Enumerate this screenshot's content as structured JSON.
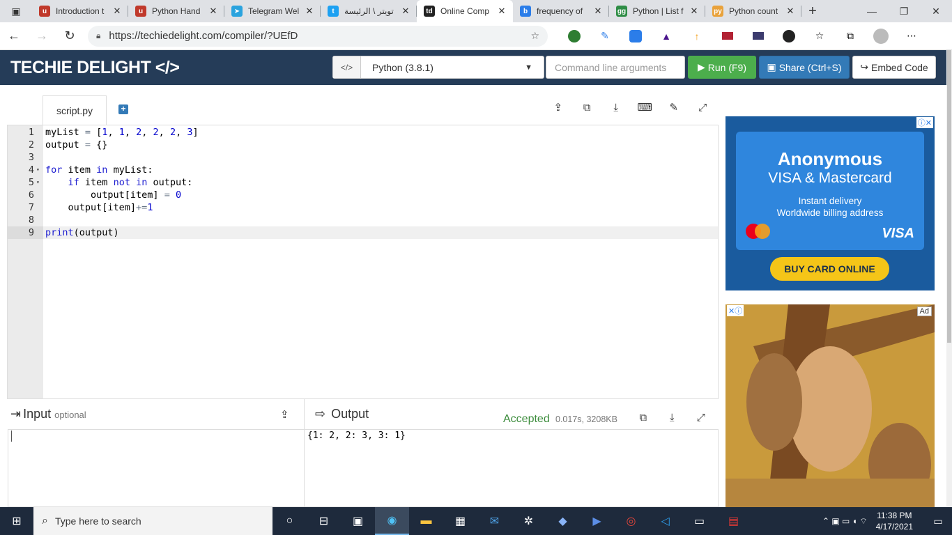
{
  "browser": {
    "tabs": [
      {
        "title": "Introduction t",
        "favicon": "u",
        "color": "#c0392b"
      },
      {
        "title": "Python Hand",
        "favicon": "u",
        "color": "#c0392b"
      },
      {
        "title": "Telegram Wel",
        "favicon": "➤",
        "color": "#2aa3de"
      },
      {
        "title": "تويتر \\ الرئيسة",
        "favicon": "t",
        "color": "#1da1f2"
      },
      {
        "title": "Online Comp",
        "favicon": "td",
        "color": "#222"
      },
      {
        "title": "frequency of",
        "favicon": "b",
        "color": "#2b7de9"
      },
      {
        "title": "Python | List f",
        "favicon": "gg",
        "color": "#2f8d46"
      },
      {
        "title": "Python count",
        "favicon": "py",
        "color": "#e9a23b"
      }
    ],
    "active_tab_index": 4,
    "url": "https://techiedelight.com/compiler/?UEfD",
    "new_tab_symbol": "+",
    "window_controls": [
      "—",
      "❐",
      "✕"
    ]
  },
  "header": {
    "logo": "TECHIE DELIGHT </>",
    "language": "Python (3.8.1)",
    "cmd_placeholder": "Command line arguments",
    "run_label": "Run (F9)",
    "share_label": "Share (Ctrl+S)",
    "embed_label": "Embed Code"
  },
  "editor": {
    "file_tab": "script.py",
    "current_line": 9,
    "lines": [
      {
        "n": "1",
        "fold": false
      },
      {
        "n": "2",
        "fold": false
      },
      {
        "n": "3",
        "fold": false
      },
      {
        "n": "4",
        "fold": true
      },
      {
        "n": "5",
        "fold": true
      },
      {
        "n": "6",
        "fold": false
      },
      {
        "n": "7",
        "fold": false
      },
      {
        "n": "8",
        "fold": false
      },
      {
        "n": "9",
        "fold": false
      }
    ],
    "code": [
      "myList = [1, 1, 2, 2, 2, 3]",
      "output = {}",
      "",
      "for item in myList:",
      "    if item not in output:",
      "        output[item] = 0",
      "    output[item]+=1",
      "",
      "print(output)"
    ],
    "tool_icons": [
      "upload-icon",
      "copy-icon",
      "download-icon",
      "keyboard-icon",
      "edit-icon",
      "fullscreen-icon"
    ]
  },
  "input": {
    "title": "Input",
    "optional_label": "optional",
    "value": ""
  },
  "output": {
    "title": "Output",
    "status": "Accepted",
    "meta": "0.017s, 3208KB",
    "text": "{1: 2, 2: 3, 3: 1}"
  },
  "ads": {
    "card": {
      "title": "Anonymous",
      "subtitle": "VISA & Mastercard",
      "line1": "Instant delivery",
      "line2": "Worldwide billing address",
      "brand": "VISA",
      "mc_text": "mastercard",
      "button": "BUY CARD ONLINE"
    },
    "ad2_badge": "Ad"
  },
  "taskbar": {
    "search_placeholder": "Type here to search",
    "time": "11:38 PM",
    "date": "4/17/2021"
  }
}
